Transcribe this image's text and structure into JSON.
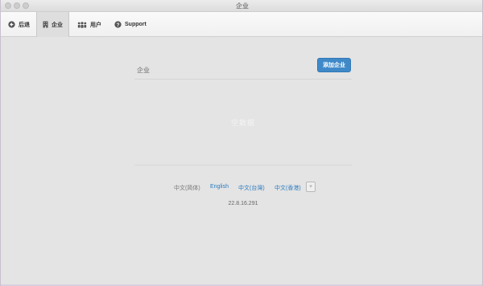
{
  "window": {
    "title": "企业"
  },
  "toolbar": {
    "back_label": "后退",
    "enterprise_label": "企业",
    "users_label": "用户",
    "support_label": "Support"
  },
  "panel": {
    "title": "企业",
    "add_button": "添加企业",
    "empty_text": "空数据"
  },
  "languages": {
    "current": "中文(简体)",
    "english": "English",
    "traditional_tw": "中文(台灣)",
    "traditional_hk": "中文(香港)",
    "more": "+"
  },
  "version": "22.8.16.291",
  "colors": {
    "accent": "#3f89c9",
    "link": "#2a7bbf",
    "background": "#e4e4e4"
  },
  "icons": {
    "back": "arrow-left-circle-icon",
    "enterprise": "building-icon",
    "users": "users-group-icon",
    "support": "question-circle-icon"
  }
}
